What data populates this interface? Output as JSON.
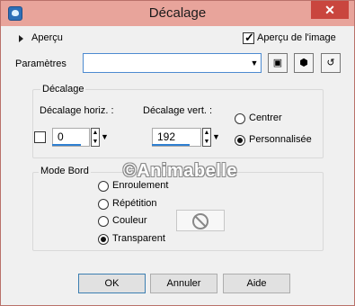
{
  "window": {
    "title": "Décalage",
    "close_glyph": "✕"
  },
  "header": {
    "apercu_label": "Aperçu",
    "apercu_image_label": "Aperçu de l'image",
    "apercu_image_checked": true
  },
  "parametres": {
    "label": "Paramètres",
    "value": "",
    "icons": [
      "save-preset-icon",
      "dice-random-icon",
      "reset-icon"
    ]
  },
  "decalage": {
    "group_label": "Décalage",
    "horiz_label": "Décalage horiz. :",
    "horiz_value": "0",
    "vert_label": "Décalage vert. :",
    "vert_value": "192",
    "centrer_label": "Centrer",
    "personnalisee_label": "Personnalisée",
    "selected": "Personnalisée",
    "link_checked": false
  },
  "mode_bord": {
    "group_label": "Mode Bord",
    "options": [
      "Enroulement",
      "Répétition",
      "Couleur",
      "Transparent"
    ],
    "selected": "Transparent"
  },
  "watermark": "©Animabelle",
  "buttons": {
    "ok": "OK",
    "cancel": "Annuler",
    "help": "Aide"
  }
}
